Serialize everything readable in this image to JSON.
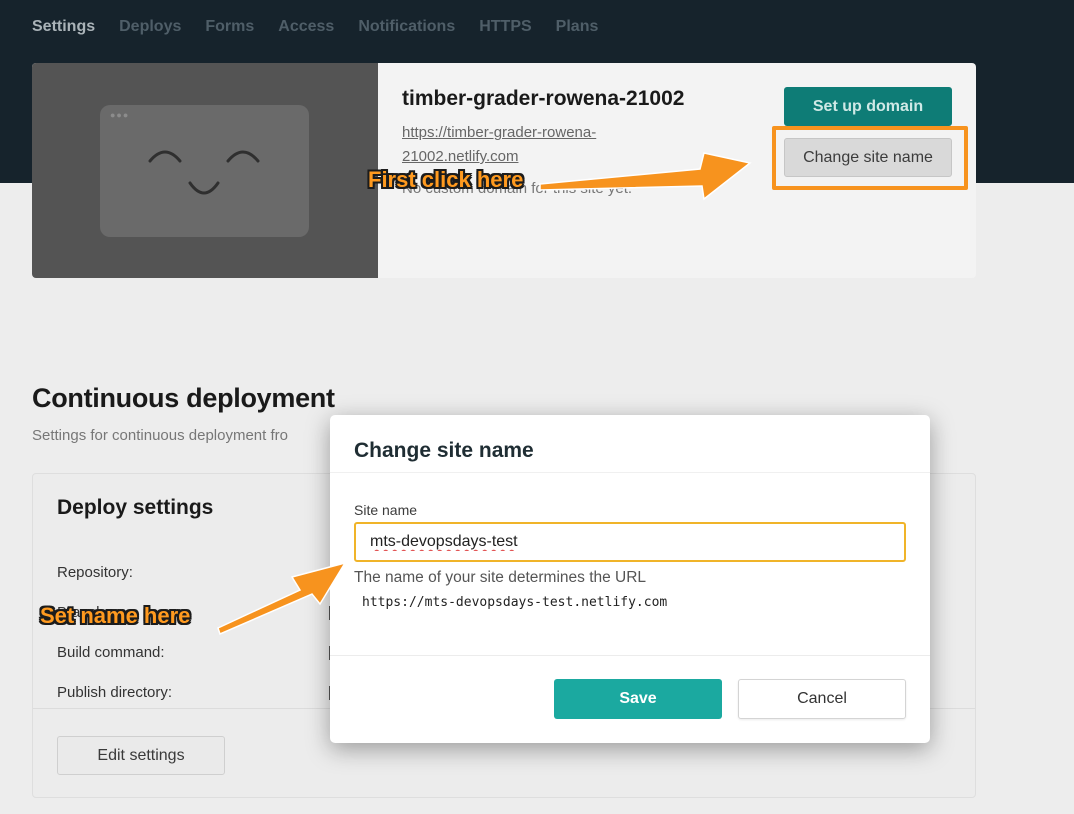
{
  "nav": {
    "tabs": [
      {
        "label": "Settings",
        "active": true
      },
      {
        "label": "Deploys"
      },
      {
        "label": "Forms"
      },
      {
        "label": "Access"
      },
      {
        "label": "Notifications"
      },
      {
        "label": "HTTPS"
      },
      {
        "label": "Plans"
      }
    ]
  },
  "site": {
    "name": "timber-grader-rowena-21002",
    "url": "https://timber-grader-rowena-21002.netlify.com",
    "no_domain_text": "No custom domain for this site yet.",
    "setup_domain_label": "Set up domain",
    "change_name_label": "Change site name"
  },
  "continuous_deployment": {
    "heading": "Continuous deployment",
    "subtitle": "Settings for continuous deployment fro"
  },
  "deploy_settings": {
    "title": "Deploy settings",
    "fields": [
      "Repository:",
      "Branch:",
      "Build command:",
      "Publish directory:"
    ],
    "edit_label": "Edit settings"
  },
  "modal": {
    "title": "Change site name",
    "field_label": "Site name",
    "value": "mts-devopsdays-test",
    "help_text": "The name of your site determines the URL",
    "url_preview": "https://mts-devopsdays-test.netlify.com",
    "save_label": "Save",
    "cancel_label": "Cancel"
  },
  "annotations": {
    "first": "First click here",
    "second": "Set name here"
  },
  "colors": {
    "accent_orange": "#f7931e",
    "primary_teal": "#1ba9a0",
    "dark_teal": "#0e7c76",
    "header_navy": "#16232c"
  }
}
